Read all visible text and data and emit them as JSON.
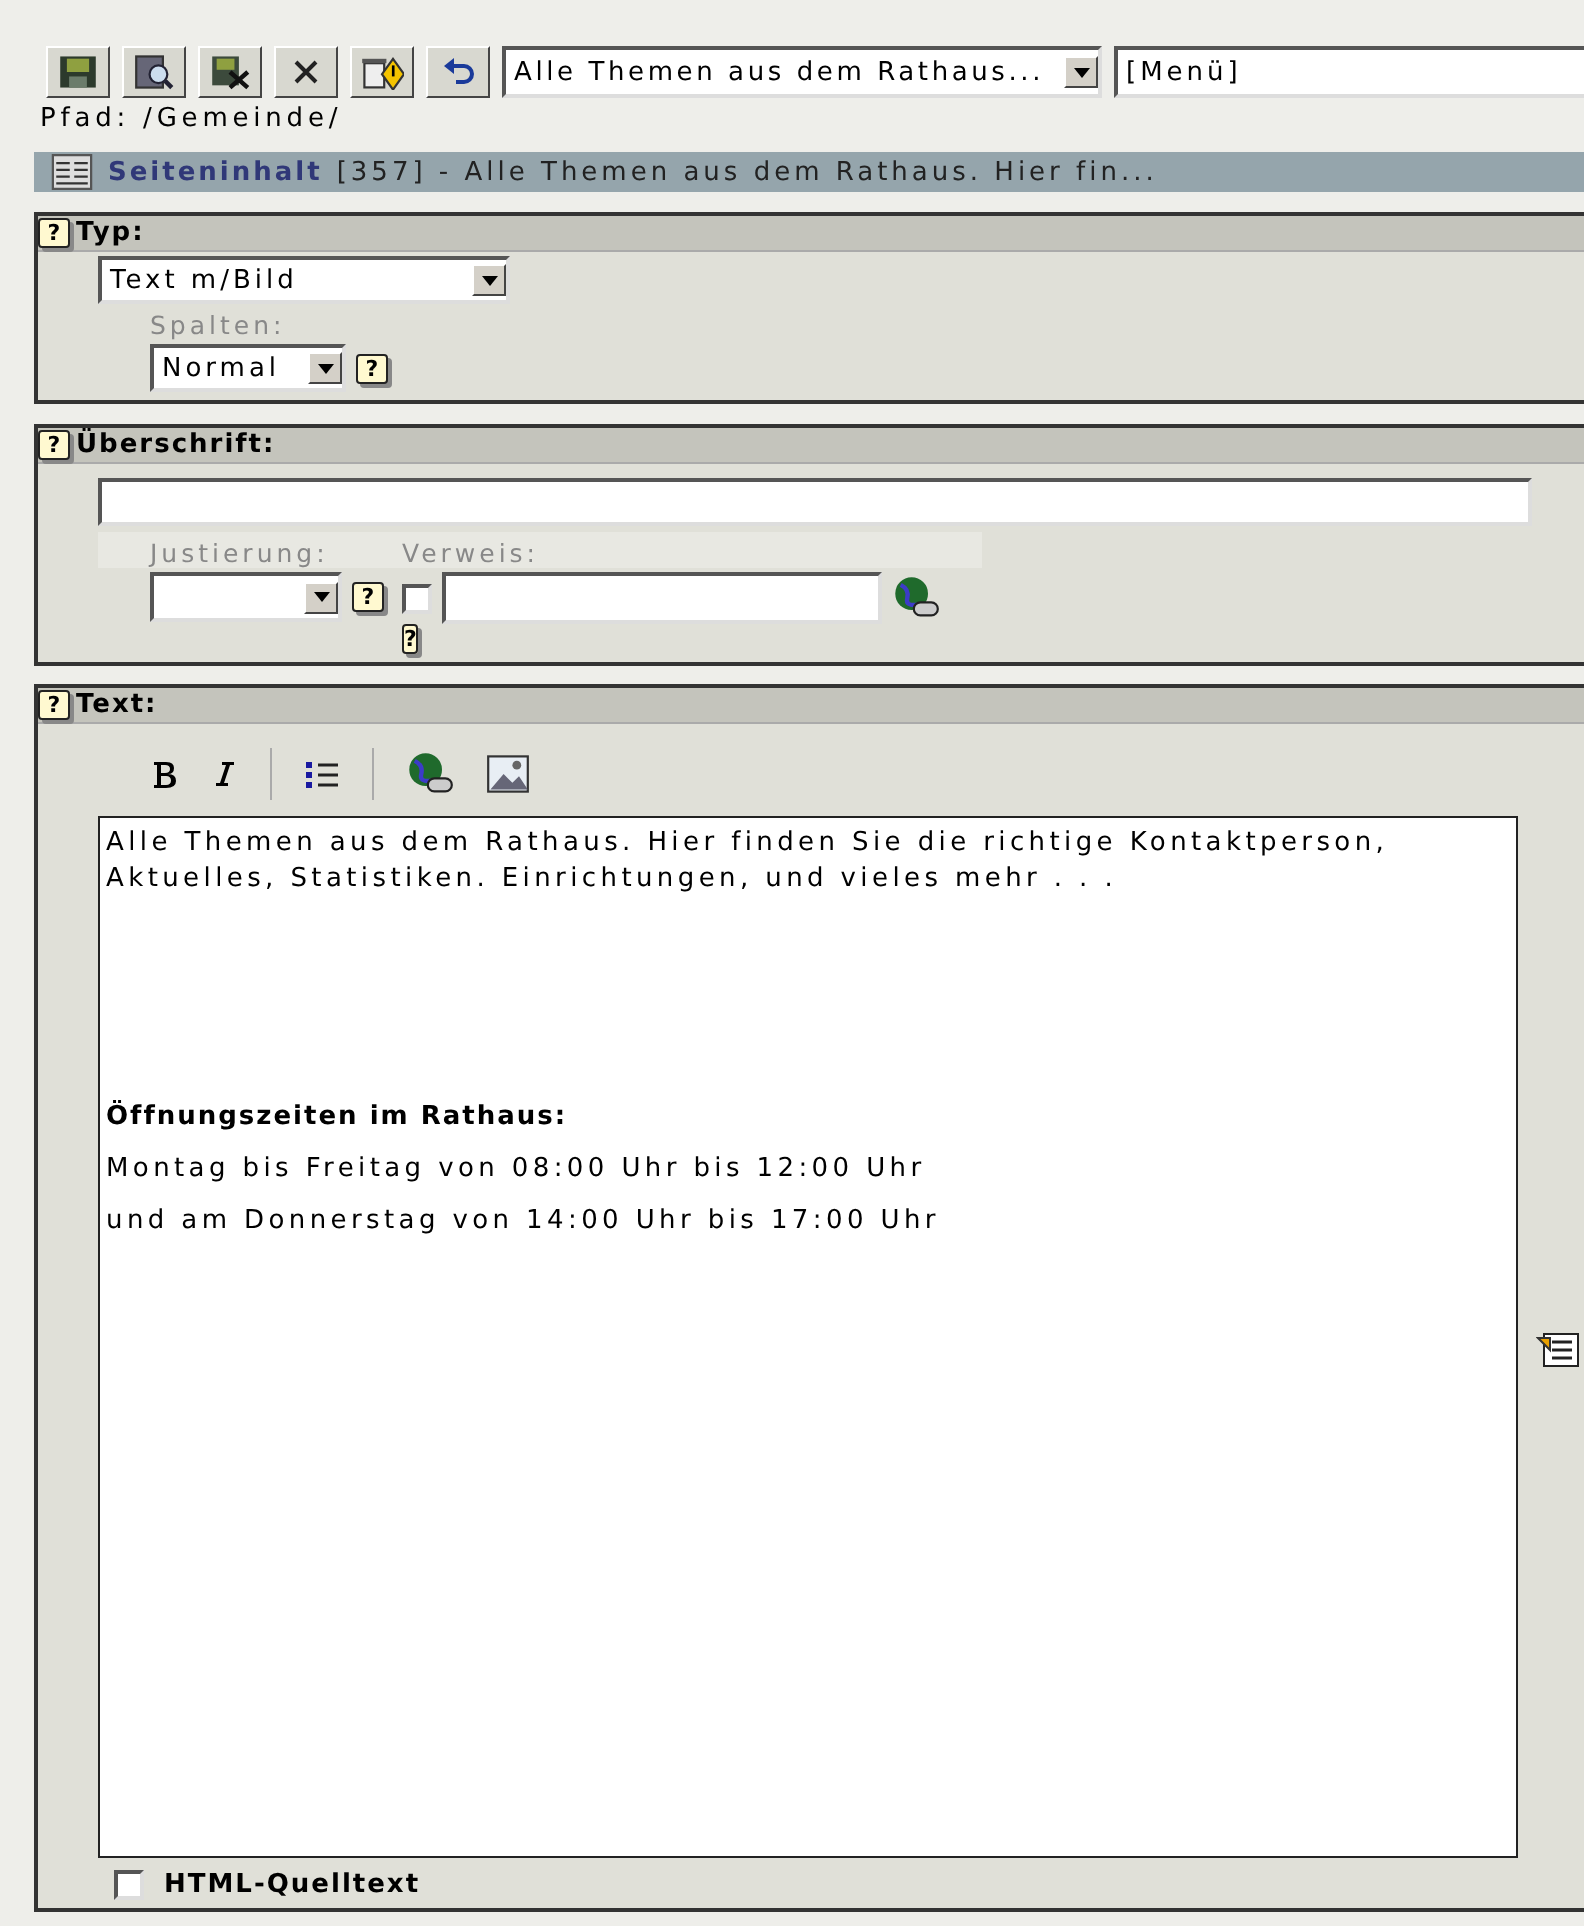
{
  "toolbar": {
    "buttons": [
      {
        "kind": "save"
      },
      {
        "kind": "preview"
      },
      {
        "kind": "save-close"
      },
      {
        "kind": "close"
      },
      {
        "kind": "delete"
      },
      {
        "kind": "undo"
      }
    ],
    "page_select": "Alle Themen aus dem Rathaus...",
    "menu_select": "[Menü]"
  },
  "path": "Pfad: /Gemeinde/",
  "record_header": {
    "type": "Seiteninhalt",
    "rest": "[357] - Alle Themen aus dem Rathaus. Hier fin..."
  },
  "typ": {
    "help": "?",
    "label": "Typ:",
    "value": "Text m/Bild",
    "columns_label": "Spalten:",
    "columns_value": "Normal",
    "columns_help": "?"
  },
  "heading": {
    "help": "?",
    "label": "Überschrift:",
    "alignment_label": "Justierung:",
    "alignment_help": "?",
    "link_label": "Verweis:",
    "link_checked": false,
    "link_help": "?"
  },
  "text": {
    "help": "?",
    "label": "Text:",
    "content": [
      {
        "kind": "para",
        "text": "Alle Themen aus dem Rathaus. Hier finden Sie die richtige Kontaktperson, Aktuelles, Statistiken. Einrichtungen, und vieles mehr . . ."
      },
      {
        "kind": "bold",
        "text": "Öffnungszeiten im Rathaus:"
      },
      {
        "kind": "line",
        "text": "Montag bis Freitag von 08:00 Uhr bis 12:00 Uhr"
      },
      {
        "kind": "line",
        "text": "und am Donnerstag von 14:00 Uhr bis 17:00 Uhr"
      }
    ],
    "html_source_label": "HTML-Quelltext",
    "html_source_checked": false
  }
}
